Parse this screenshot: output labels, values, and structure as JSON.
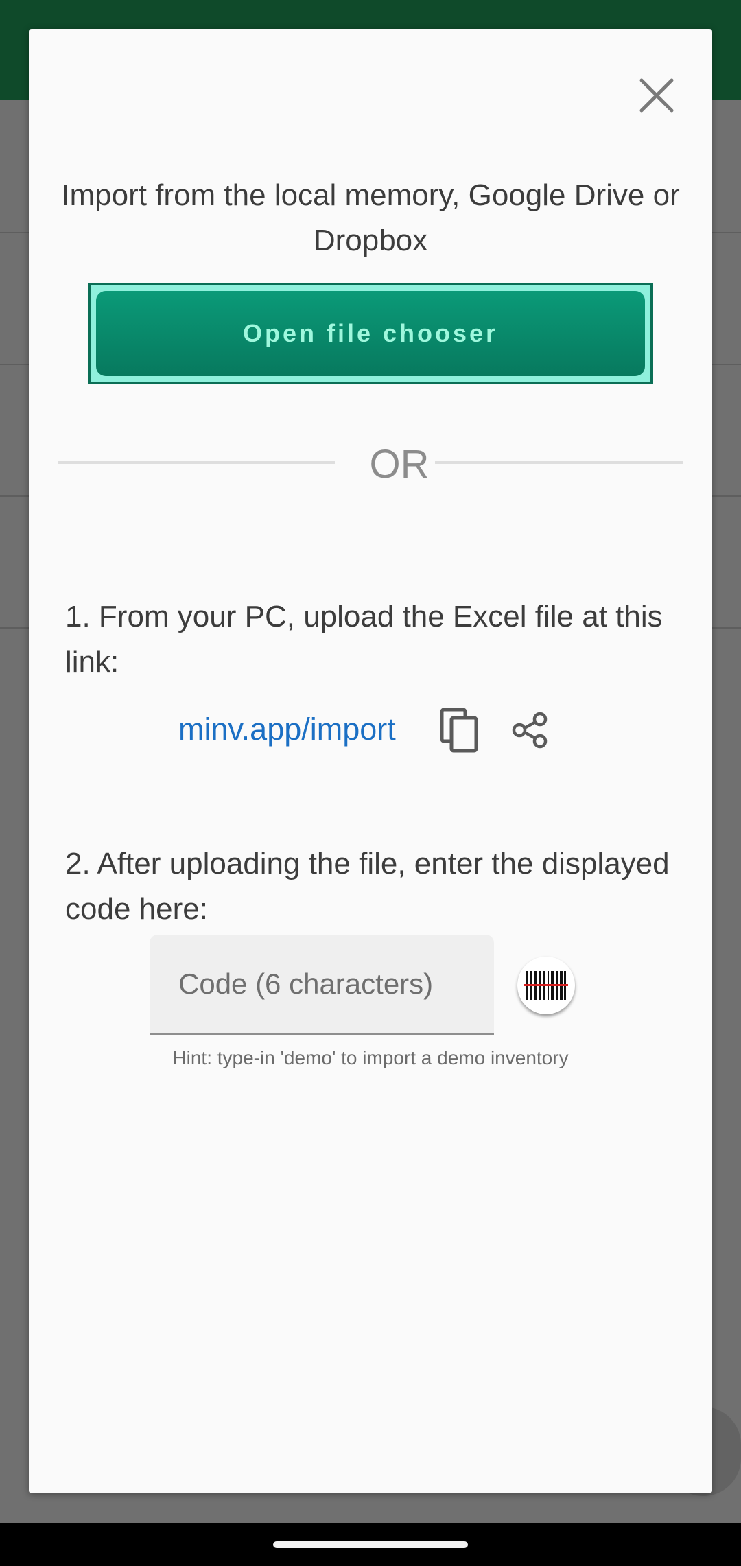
{
  "dialog": {
    "intro": "Import from the local memory, Google Drive or Dropbox",
    "open_file_chooser_label": "Open file chooser",
    "or_label": "OR",
    "step1": "1. From your PC, upload the Excel file at this link:",
    "import_link": "minv.app/import",
    "step2": "2. After uploading the file, enter the displayed code here:",
    "code_placeholder": "Code (6 characters)",
    "hint": "Hint: type-in 'demo' to import a demo inventory",
    "icons": {
      "close": "close-icon",
      "copy": "copy-icon",
      "share": "share-icon",
      "scan": "barcode-icon"
    }
  },
  "colors": {
    "app_bar": "#0f4a2a",
    "button_gradient_top": "#0b9a78",
    "button_highlight": "#8ff0dc",
    "link": "#1b6fc4"
  }
}
